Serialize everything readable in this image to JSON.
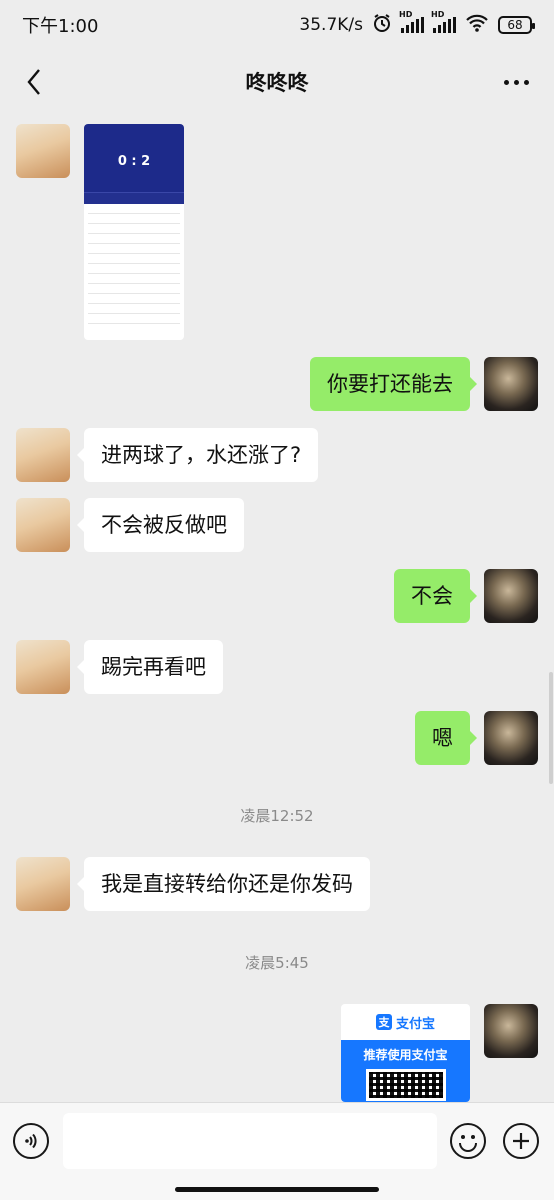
{
  "status_bar": {
    "time": "下午1:00",
    "network_speed": "35.7K/s",
    "hd_label": "HD",
    "battery": "68"
  },
  "header": {
    "title": "咚咚咚"
  },
  "messages": [
    {
      "from": "them",
      "type": "image",
      "description_icon": "match-screenshot",
      "score": "0 : 2"
    },
    {
      "from": "me",
      "text": "你要打还能去"
    },
    {
      "from": "them",
      "text": "进两球了，水还涨了?"
    },
    {
      "from": "them",
      "text": "不会被反做吧"
    },
    {
      "from": "me",
      "text": "不会"
    },
    {
      "from": "them",
      "text": "踢完再看吧"
    },
    {
      "from": "me",
      "text": "嗯"
    },
    {
      "from": "them",
      "text": "我是直接转给你还是你发码"
    },
    {
      "from": "me",
      "type": "alipay-card",
      "brand": "支付宝",
      "brand_logo": "支",
      "caption": "推荐使用支付宝"
    }
  ],
  "timestamps": [
    "凌晨12:52",
    "凌晨5:45"
  ],
  "input": {
    "placeholder": "",
    "value": ""
  },
  "colors": {
    "my_bubble": "#95ec69",
    "their_bubble": "#ffffff",
    "background": "#ededed",
    "alipay_blue": "#1677ff"
  }
}
